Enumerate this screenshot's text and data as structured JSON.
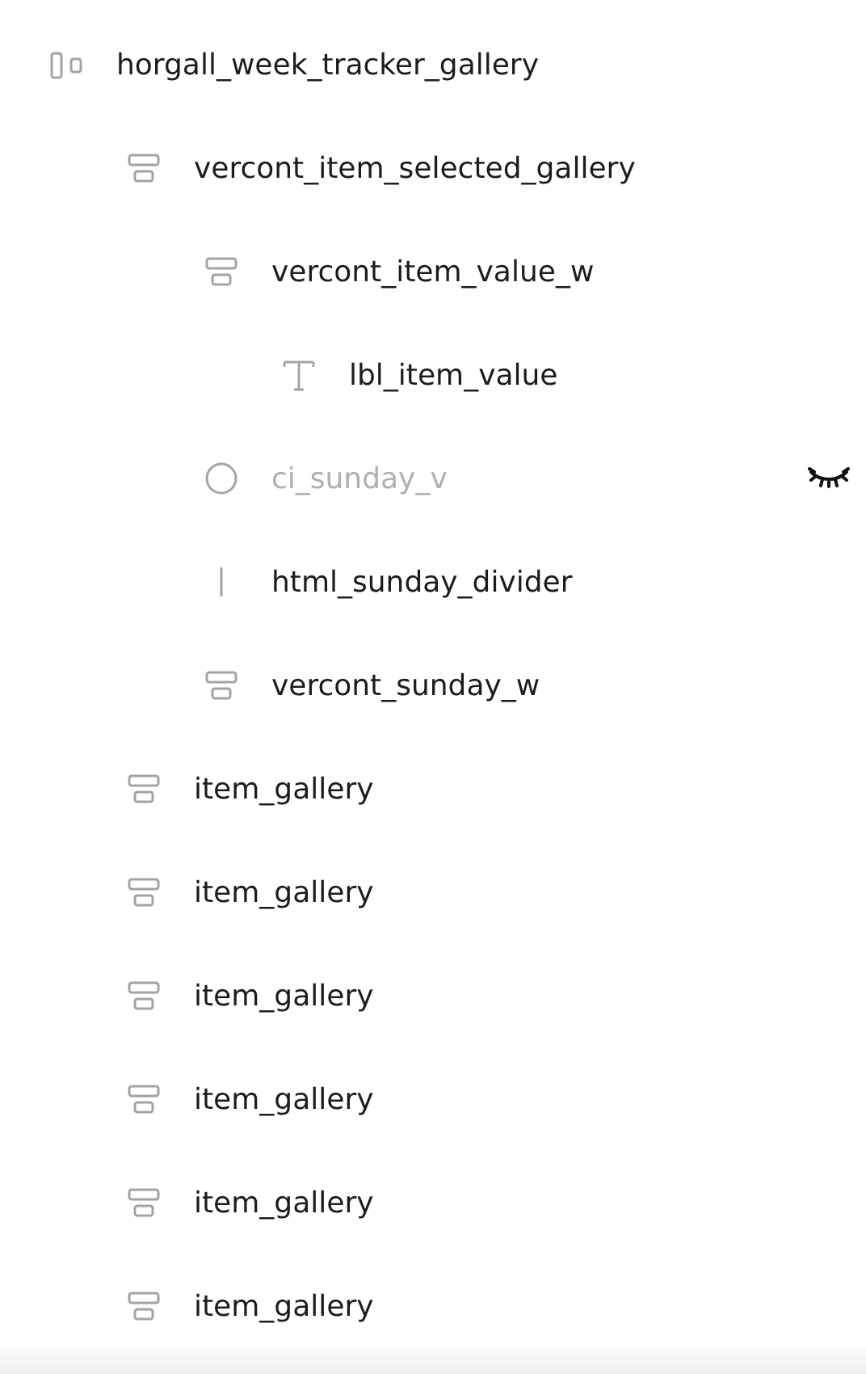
{
  "layers": [
    {
      "kind": "hcontainer",
      "label": "horgall_week_tracker_gallery",
      "hidden": false,
      "children": [
        {
          "kind": "vcontainer",
          "label": "vercont_item_selected_gallery",
          "hidden": false,
          "children": [
            {
              "kind": "vcontainer",
              "label": "vercont_item_value_w",
              "hidden": false,
              "children": [
                {
                  "kind": "text",
                  "label": "lbl_item_value",
                  "hidden": false
                }
              ]
            },
            {
              "kind": "circle",
              "label": "ci_sunday_v",
              "hidden": true
            },
            {
              "kind": "divider",
              "label": "html_sunday_divider",
              "hidden": false
            },
            {
              "kind": "vcontainer",
              "label": "vercont_sunday_w",
              "hidden": false
            }
          ]
        },
        {
          "kind": "vcontainer",
          "label": "item_gallery",
          "hidden": false
        },
        {
          "kind": "vcontainer",
          "label": "item_gallery",
          "hidden": false
        },
        {
          "kind": "vcontainer",
          "label": "item_gallery",
          "hidden": false
        },
        {
          "kind": "vcontainer",
          "label": "item_gallery",
          "hidden": false
        },
        {
          "kind": "vcontainer",
          "label": "item_gallery",
          "hidden": false
        },
        {
          "kind": "vcontainer",
          "label": "item_gallery",
          "hidden": false
        }
      ]
    }
  ]
}
